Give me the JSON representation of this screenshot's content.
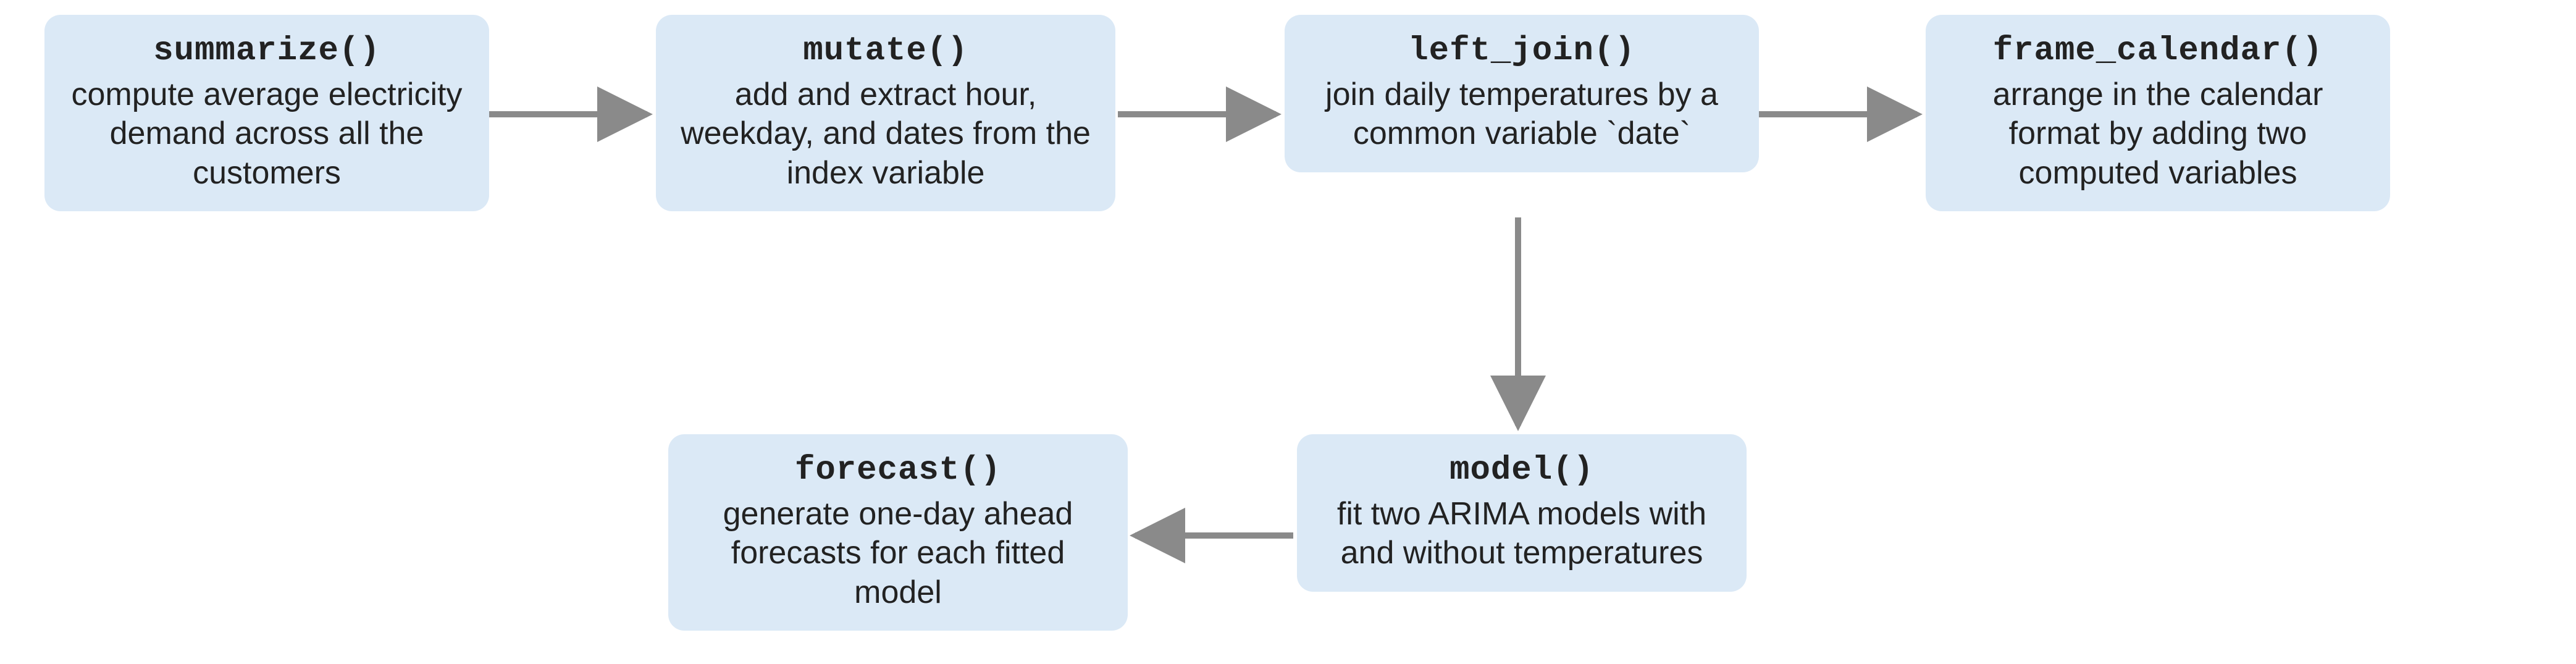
{
  "nodes": {
    "summarize": {
      "title": "summarize()",
      "desc": "compute average electricity demand across all the customers"
    },
    "mutate": {
      "title": "mutate()",
      "desc": "add and extract hour, weekday, and dates from the index variable"
    },
    "left_join": {
      "title": "left_join()",
      "desc": "join daily temperatures by a common variable `date`"
    },
    "frame_calendar": {
      "title": "frame_calendar()",
      "desc": "arrange in the calendar format by adding two computed variables"
    },
    "model": {
      "title": "model()",
      "desc": "fit two ARIMA models with and without temperatures"
    },
    "forecast": {
      "title": "forecast()",
      "desc": "generate one-day ahead forecasts for each fitted model"
    }
  }
}
